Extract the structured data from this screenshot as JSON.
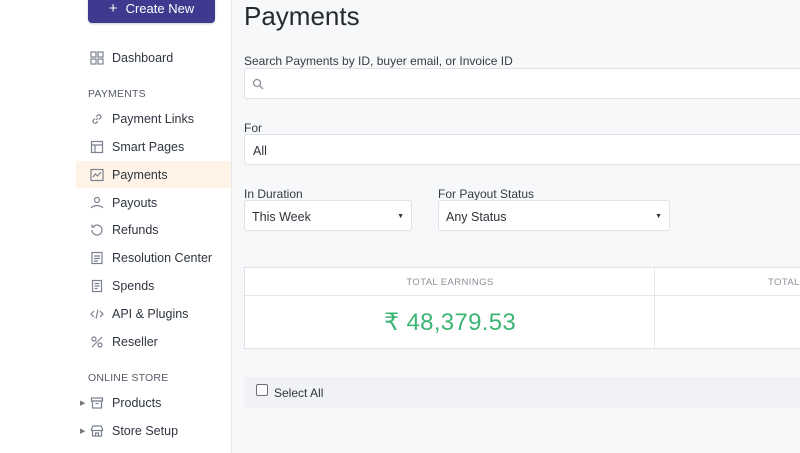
{
  "sidebar": {
    "create_button": "Create New",
    "dashboard": "Dashboard",
    "payments_section": "PAYMENTS",
    "items": [
      {
        "label": "Payment Links",
        "icon": "link-icon"
      },
      {
        "label": "Smart Pages",
        "icon": "page-icon"
      },
      {
        "label": "Payments",
        "icon": "chart-icon",
        "active": true
      },
      {
        "label": "Payouts",
        "icon": "payouts-icon"
      },
      {
        "label": "Refunds",
        "icon": "refund-icon"
      },
      {
        "label": "Resolution Center",
        "icon": "resolution-icon"
      },
      {
        "label": "Spends",
        "icon": "spends-icon"
      },
      {
        "label": "API & Plugins",
        "icon": "code-icon"
      },
      {
        "label": "Reseller",
        "icon": "reseller-icon"
      }
    ],
    "store_section": "ONLINE STORE",
    "store_items": [
      {
        "label": "Products",
        "icon": "products-icon"
      },
      {
        "label": "Store Setup",
        "icon": "store-icon"
      }
    ]
  },
  "main": {
    "title": "Payments",
    "search_label": "Search Payments by ID, buyer email, or Invoice ID",
    "search_placeholder": "",
    "for_label": "For",
    "for_value": "All",
    "duration_label": "In Duration",
    "duration_value": "This Week",
    "payout_label": "For Payout Status",
    "payout_value": "Any Status",
    "total_earnings_label": "TOTAL EARNINGS",
    "total_earnings_value": "₹ 48,379.53",
    "second_col_label": "TOTAL",
    "select_all": "Select All"
  },
  "colors": {
    "brand": "#3d3a8f",
    "active_bg": "#fff3e8",
    "earnings_green": "#3cb574"
  }
}
